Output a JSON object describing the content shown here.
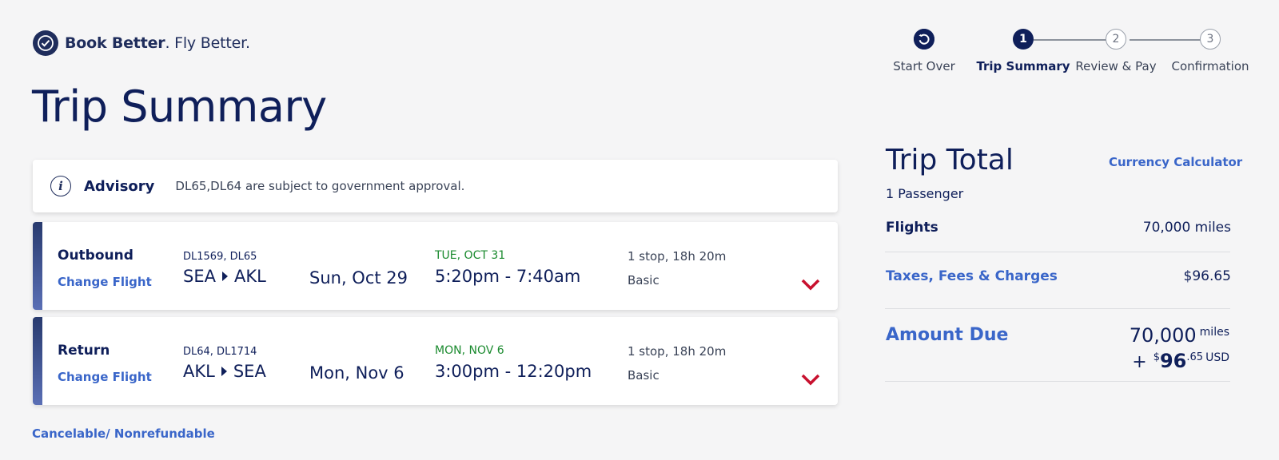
{
  "brand": {
    "text_bold": "Book Better",
    "text_rest": ". Fly Better."
  },
  "page_title": "Trip Summary",
  "stepper": {
    "steps": [
      {
        "label": "Start Over",
        "number": ""
      },
      {
        "label": "Trip Summary",
        "number": "1"
      },
      {
        "label": "Review & Pay",
        "number": "2"
      },
      {
        "label": "Confirmation",
        "number": "3"
      }
    ]
  },
  "advisory": {
    "title": "Advisory",
    "message": "DL65,DL64 are subject to government approval."
  },
  "flights": [
    {
      "direction": "Outbound",
      "change_label": "Change Flight",
      "flight_numbers": "DL1569, DL65",
      "origin": "SEA",
      "destination": "AKL",
      "date": "Sun, Oct 29",
      "arrival_day": "TUE, OCT 31",
      "times": "5:20pm - 7:40am",
      "stops": "1 stop, 18h 20m",
      "cabin": "Basic"
    },
    {
      "direction": "Return",
      "change_label": "Change Flight",
      "flight_numbers": "DL64, DL1714",
      "origin": "AKL",
      "destination": "SEA",
      "date": "Mon, Nov 6",
      "arrival_day": "MON, NOV 6",
      "times": "3:00pm - 12:20pm",
      "stops": "1 stop, 18h 20m",
      "cabin": "Basic"
    }
  ],
  "cancel_policy": "Cancelable/ Nonrefundable",
  "trip_total": {
    "title": "Trip Total",
    "currency_calculator": "Currency Calculator",
    "passengers": "1 Passenger",
    "flights_label": "Flights",
    "flights_value": "70,000 miles",
    "taxes_label": "Taxes, Fees & Charges",
    "taxes_value": "$96.65",
    "amount_due_label": "Amount Due",
    "amount_due_miles": "70,000",
    "amount_due_miles_unit": "miles",
    "amount_due_plus": "+",
    "amount_due_currency_symbol": "$",
    "amount_due_dollars": "96",
    "amount_due_cents": ".65",
    "amount_due_currency": "USD"
  },
  "colors": {
    "navy": "#0f1f5a",
    "link": "#3a66c9",
    "arrival_green": "#1a8a2e",
    "chevron_red": "#c8102e"
  }
}
